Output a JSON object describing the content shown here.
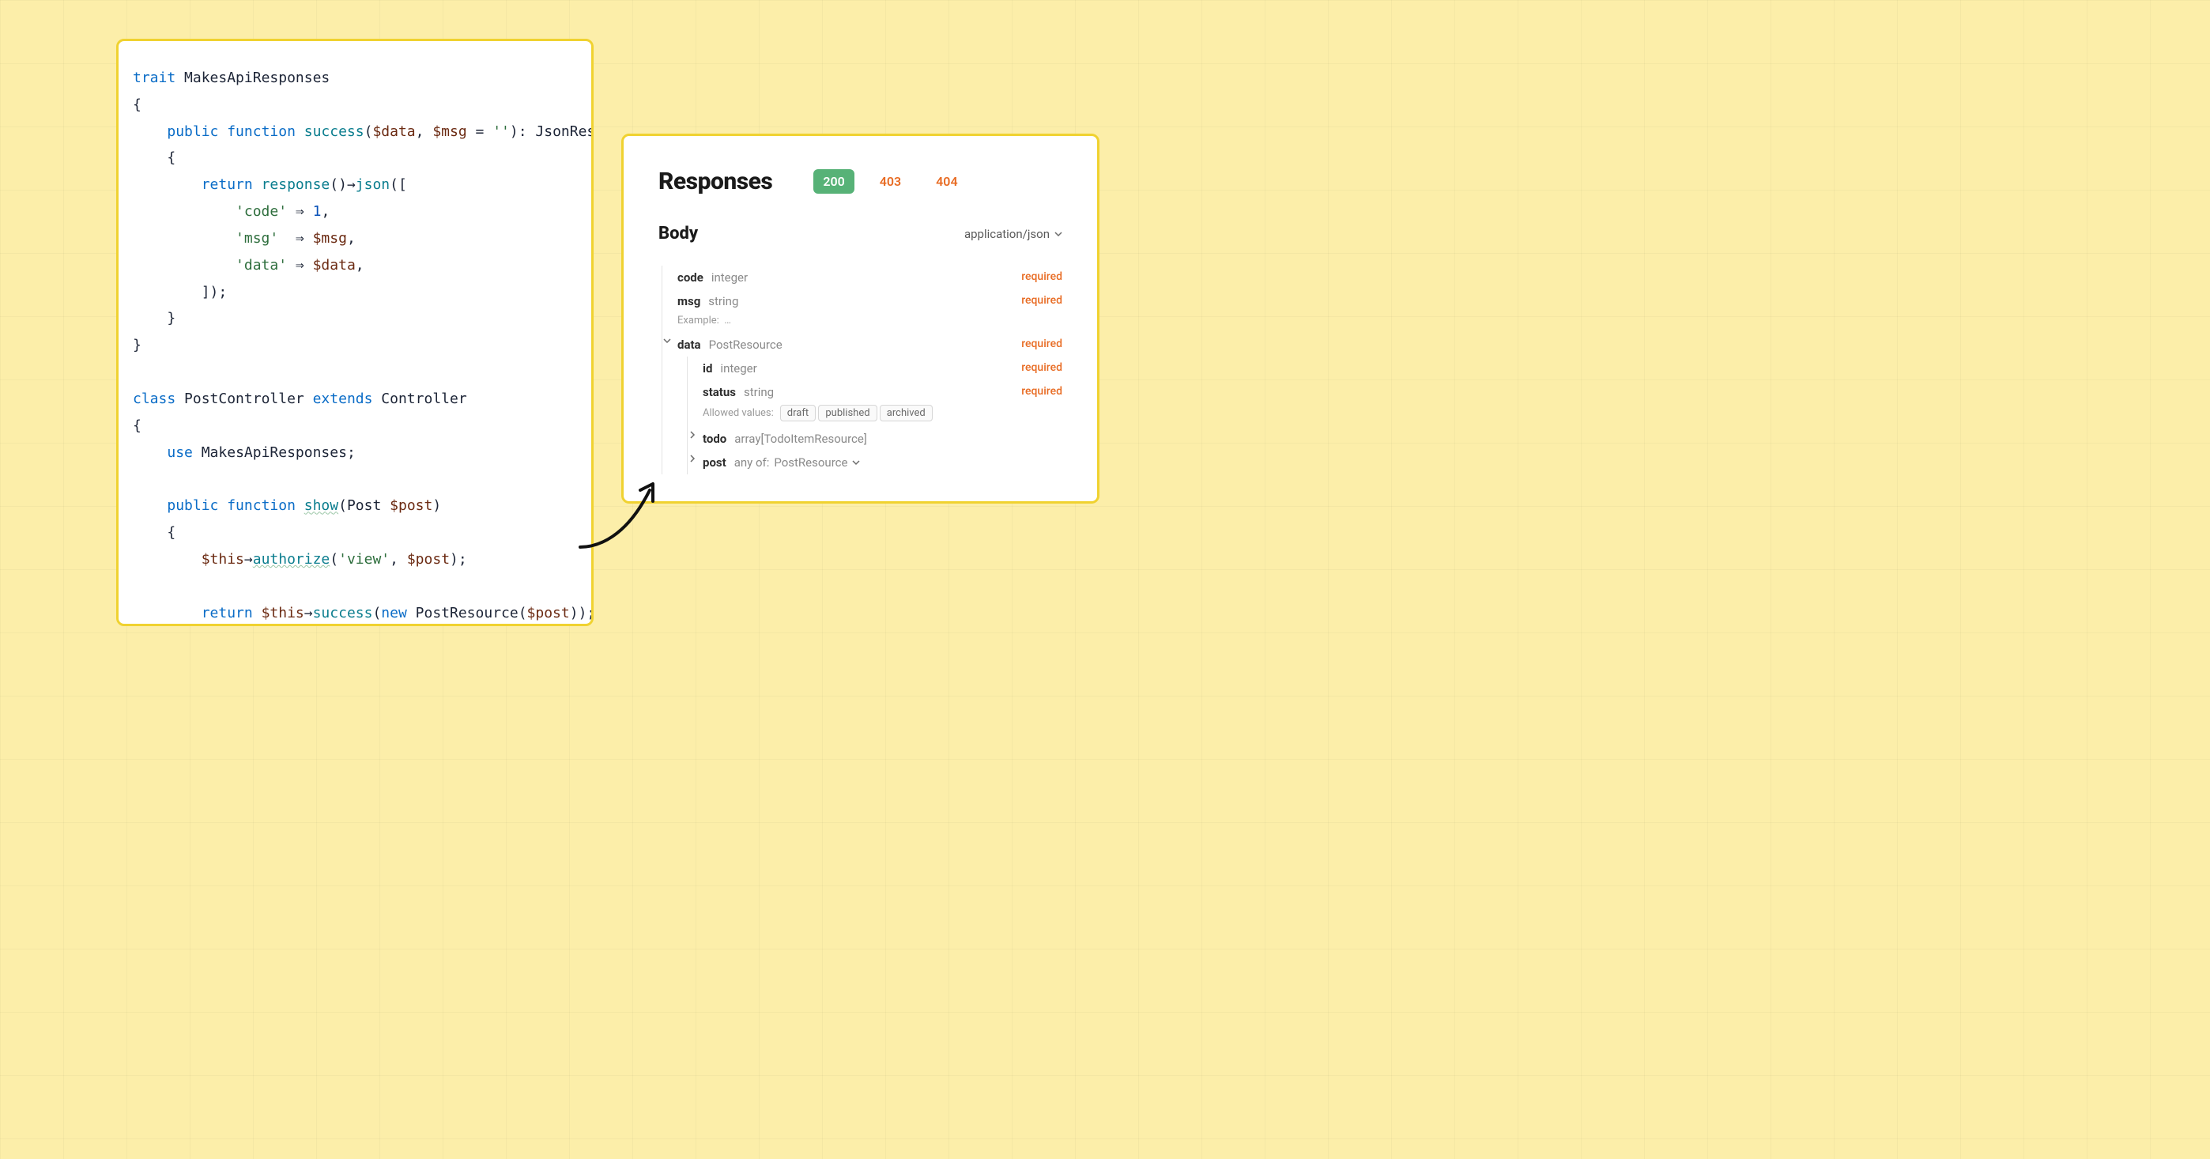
{
  "code": {
    "lines": [
      [
        [
          "trait ",
          "kw-blue"
        ],
        [
          "MakesApiResponses",
          ""
        ]
      ],
      [
        [
          "{",
          ""
        ]
      ],
      [
        [
          "    ",
          ""
        ],
        [
          "public function ",
          "kw-blue"
        ],
        [
          "success",
          "fn-teal"
        ],
        [
          "(",
          ""
        ],
        [
          "$data",
          "var"
        ],
        [
          ", ",
          ""
        ],
        [
          "$msg",
          "var"
        ],
        [
          " = ",
          ""
        ],
        [
          "''",
          "str"
        ],
        [
          "): JsonResponse",
          ""
        ]
      ],
      [
        [
          "    {",
          ""
        ]
      ],
      [
        [
          "        ",
          ""
        ],
        [
          "return ",
          "kw-blue"
        ],
        [
          "response",
          "fn-teal"
        ],
        [
          "()→",
          ""
        ],
        [
          "json",
          "fn-teal"
        ],
        [
          "([",
          ""
        ]
      ],
      [
        [
          "            ",
          ""
        ],
        [
          "'code'",
          "str"
        ],
        [
          " ⇒ ",
          ""
        ],
        [
          "1",
          "num"
        ],
        [
          ",",
          ""
        ]
      ],
      [
        [
          "            ",
          ""
        ],
        [
          "'msg'",
          "str"
        ],
        [
          "  ⇒ ",
          ""
        ],
        [
          "$msg",
          "var"
        ],
        [
          ",",
          ""
        ]
      ],
      [
        [
          "            ",
          ""
        ],
        [
          "'data'",
          "str"
        ],
        [
          " ⇒ ",
          ""
        ],
        [
          "$data",
          "var"
        ],
        [
          ",",
          ""
        ]
      ],
      [
        [
          "        ]);",
          ""
        ]
      ],
      [
        [
          "    }",
          ""
        ]
      ],
      [
        [
          "}",
          ""
        ]
      ],
      [
        [
          "",
          ""
        ]
      ],
      [
        [
          "class ",
          "kw-blue"
        ],
        [
          "PostController ",
          ""
        ],
        [
          "extends ",
          "kw-blue"
        ],
        [
          "Controller",
          ""
        ]
      ],
      [
        [
          "{",
          ""
        ]
      ],
      [
        [
          "    ",
          ""
        ],
        [
          "use ",
          "kw-blue"
        ],
        [
          "MakesApiResponses;",
          ""
        ]
      ],
      [
        [
          "",
          ""
        ]
      ],
      [
        [
          "    ",
          ""
        ],
        [
          "public function ",
          "kw-blue"
        ],
        [
          "show",
          "fn-teal underline-wavy"
        ],
        [
          "(Post ",
          ""
        ],
        [
          "$post",
          "var"
        ],
        [
          ")",
          ""
        ]
      ],
      [
        [
          "    {",
          ""
        ]
      ],
      [
        [
          "        ",
          ""
        ],
        [
          "$this",
          "var"
        ],
        [
          "→",
          ""
        ],
        [
          "authorize",
          "fn-teal underline-wavy"
        ],
        [
          "(",
          ""
        ],
        [
          "'view'",
          "str"
        ],
        [
          ", ",
          ""
        ],
        [
          "$post",
          "var"
        ],
        [
          ");",
          ""
        ]
      ],
      [
        [
          "",
          ""
        ]
      ],
      [
        [
          "        ",
          ""
        ],
        [
          "return ",
          "kw-blue"
        ],
        [
          "$this",
          "var"
        ],
        [
          "→",
          ""
        ],
        [
          "success",
          "fn-teal"
        ],
        [
          "(",
          ""
        ],
        [
          "new ",
          "kw-blue"
        ],
        [
          "PostResource(",
          ""
        ],
        [
          "$post",
          "var"
        ],
        [
          "));",
          ""
        ]
      ],
      [
        [
          "    }",
          ""
        ]
      ]
    ]
  },
  "doc": {
    "title": "Responses",
    "status_codes": [
      "200",
      "403",
      "404"
    ],
    "active_status": "200",
    "body_title": "Body",
    "content_type": "application/json",
    "example_label": "Example:",
    "example_value": "…",
    "allowed_values_label": "Allowed values:",
    "schema": {
      "code": {
        "name": "code",
        "type": "integer",
        "required": "required"
      },
      "msg": {
        "name": "msg",
        "type": "string",
        "required": "required"
      },
      "data": {
        "name": "data",
        "type": "PostResource",
        "required": "required"
      },
      "id": {
        "name": "id",
        "type": "integer",
        "required": "required"
      },
      "status": {
        "name": "status",
        "type": "string",
        "required": "required",
        "allowed": [
          "draft",
          "published",
          "archived"
        ]
      },
      "todo": {
        "name": "todo",
        "type": "array[TodoItemResource]"
      },
      "post": {
        "name": "post",
        "type_prefix": "any of:",
        "type_value": "PostResource"
      }
    }
  }
}
